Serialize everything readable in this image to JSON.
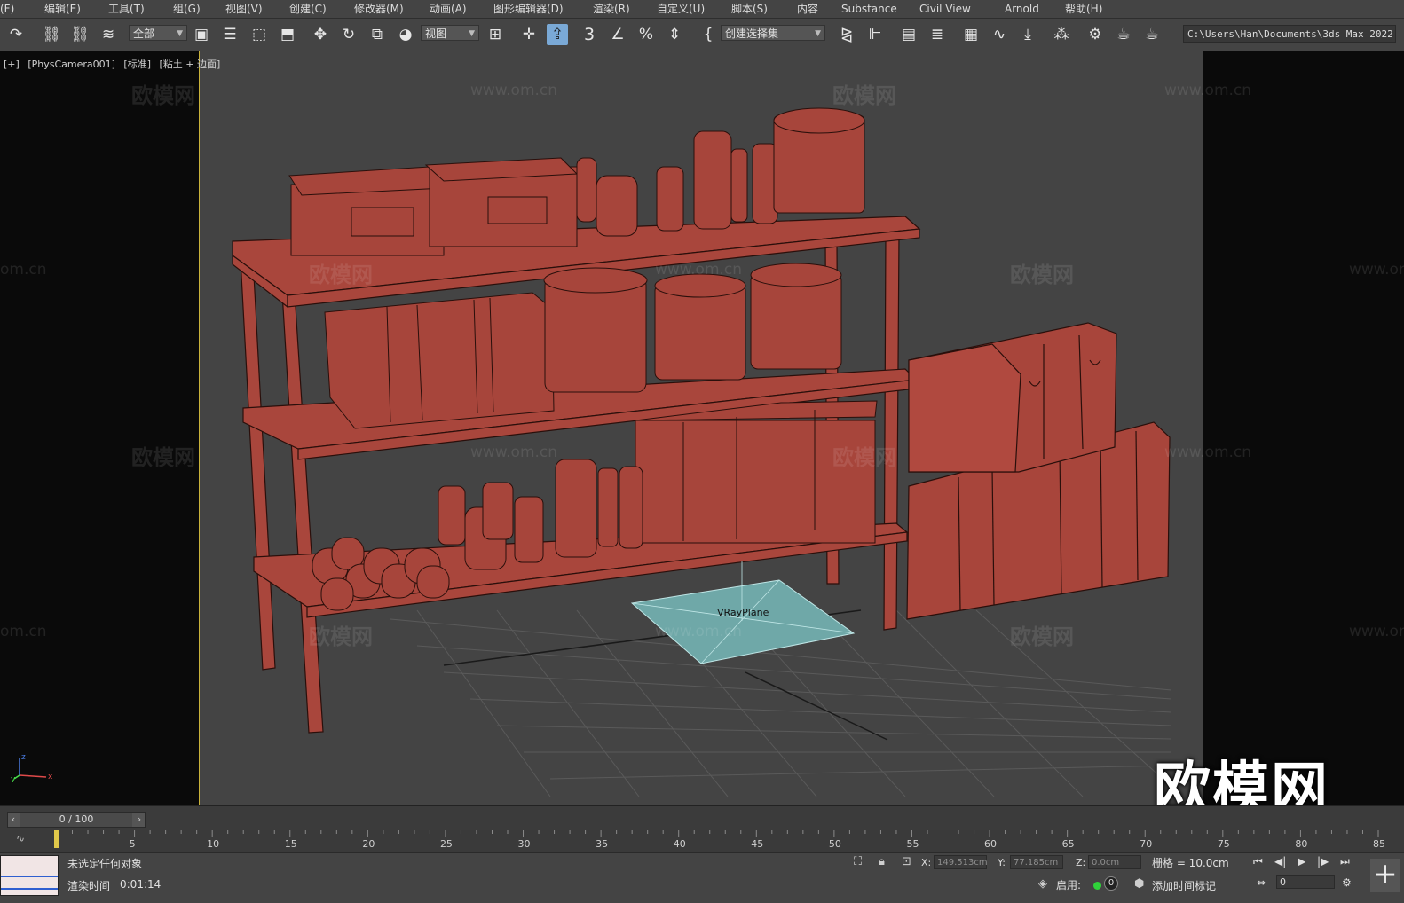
{
  "menu": {
    "file": "(F)",
    "edit": "编辑(E)",
    "tools": "工具(T)",
    "group": "组(G)",
    "views": "视图(V)",
    "create": "创建(C)",
    "modifiers": "修改器(M)",
    "animation": "动画(A)",
    "graph_editors": "图形编辑器(D)",
    "rendering": "渲染(R)",
    "customize": "自定义(U)",
    "scripting": "脚本(S)",
    "content": "内容",
    "substance": "Substance",
    "civil_view": "Civil View",
    "arnold": "Arnold",
    "help": "帮助(H)"
  },
  "toolbar": {
    "selection_filter": "全部",
    "ref_coord": "视图",
    "named_selection": "创建选择集",
    "snap_3": "3",
    "path": "C:\\Users\\Han\\Documents\\3ds Max 2022"
  },
  "viewport": {
    "plus": "[+]",
    "camera": "[PhysCamera001]",
    "mode": "[标准]",
    "shading": "[粘土 + 边面]",
    "object_label": "VRayPlane",
    "watermark_logo": "欧模网",
    "watermark_url": "www.om.cn",
    "watermark_url_partial": "om.cn",
    "watermark_url_partial_right": "www.om",
    "big_watermark": "欧模网",
    "axis_z": "z",
    "axis_x": "x",
    "axis_y": "y"
  },
  "timeline": {
    "frame_display": "0 / 100",
    "current_frame": 0,
    "total_frames": 100,
    "tick_labels": [
      "5",
      "10",
      "15",
      "20",
      "25",
      "30",
      "35",
      "40",
      "45",
      "50",
      "55",
      "60",
      "65",
      "70",
      "75",
      "80",
      "85"
    ]
  },
  "status": {
    "selection": "未选定任何对象",
    "render_time_label": "渲染时间",
    "render_time": "0:01:14",
    "x_label": "X:",
    "x_value": "149.513cm",
    "y_label": "Y:",
    "y_value": "77.185cm",
    "z_label": "Z:",
    "z_value": "0.0cm",
    "grid": "栅格 = 10.0cm",
    "enable_label": "启用:",
    "enable_count": "0",
    "add_time_tag": "添加时间标记",
    "frame_input": "0"
  }
}
